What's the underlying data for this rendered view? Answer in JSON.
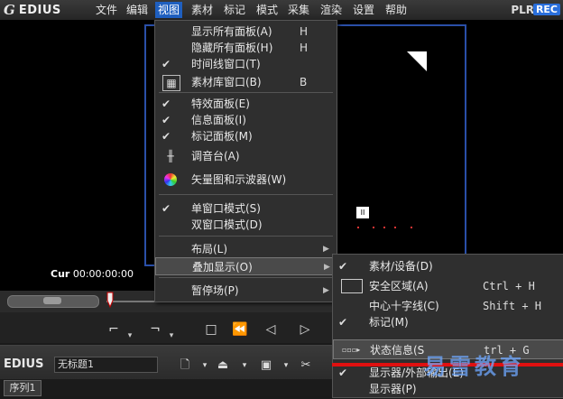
{
  "app": {
    "logo_mark": "G",
    "name": "EDIUS",
    "plr": "PLR",
    "rec": "REC"
  },
  "menubar": [
    {
      "label": "文件",
      "active": false
    },
    {
      "label": "编辑",
      "active": false
    },
    {
      "label": "视图",
      "active": true
    },
    {
      "label": "素材",
      "active": false
    },
    {
      "label": "标记",
      "active": false
    },
    {
      "label": "模式",
      "active": false
    },
    {
      "label": "采集",
      "active": false
    },
    {
      "label": "渲染",
      "active": false
    },
    {
      "label": "设置",
      "active": false
    },
    {
      "label": "帮助",
      "active": false
    }
  ],
  "monitor": {
    "cur_label": "Cur",
    "cur_time": "00:00:00:00"
  },
  "view_menu": {
    "items": [
      {
        "label": "显示所有面板(A)",
        "key": "H",
        "checked": false
      },
      {
        "label": "隐藏所有面板(H)",
        "key": "H",
        "checked": false
      },
      {
        "label": "时间线窗口(T)",
        "key": "",
        "checked": true
      },
      {
        "label": "素材库窗口(B)",
        "key": "B",
        "checked": false,
        "icon": "bin-icon"
      },
      {
        "label": "特效面板(E)",
        "key": "",
        "checked": true
      },
      {
        "label": "信息面板(I)",
        "key": "",
        "checked": true
      },
      {
        "label": "标记面板(M)",
        "key": "",
        "checked": true
      },
      {
        "label": "调音台(A)",
        "key": "",
        "checked": false,
        "icon": "mixer-icon"
      },
      {
        "label": "矢量图和示波器(W)",
        "key": "",
        "checked": false,
        "icon": "vectorscope-icon"
      },
      {
        "label": "单窗口模式(S)",
        "key": "",
        "checked": true
      },
      {
        "label": "双窗口模式(D)",
        "key": "",
        "checked": false
      },
      {
        "label": "布局(L)",
        "key": "",
        "checked": false,
        "submenu": true
      },
      {
        "label": "叠加显示(O)",
        "key": "",
        "checked": false,
        "submenu": true,
        "highlighted": true
      },
      {
        "label": "暂停场(P)",
        "key": "",
        "checked": false,
        "submenu": true
      }
    ]
  },
  "overlay_menu": {
    "items": [
      {
        "label": "素材/设备(D)",
        "key": "",
        "checked": true
      },
      {
        "label": "安全区域(A)",
        "key": "Ctrl + H",
        "checked": false,
        "icon": "safe-area-icon"
      },
      {
        "label": "中心十字线(C)",
        "key": "Shift + H",
        "checked": false
      },
      {
        "label": "标记(M)",
        "key": "",
        "checked": true
      },
      {
        "label": "状态信息(S",
        "key": "trl + G",
        "checked": false,
        "icon": "status-info-icon",
        "highlighted": true
      },
      {
        "label": "显示器/外部输出(E)",
        "key": "",
        "checked": true
      },
      {
        "label": "显示器(P)",
        "key": "",
        "checked": false
      }
    ]
  },
  "editbar": {
    "edius": "EDIUS",
    "project": "无标题1"
  },
  "sequence": {
    "tab": "序列1"
  },
  "watermark": "易雪教育",
  "colors": {
    "accent": "#1f5fbf",
    "frame": "#2a4fa8",
    "red": "#e01010"
  }
}
